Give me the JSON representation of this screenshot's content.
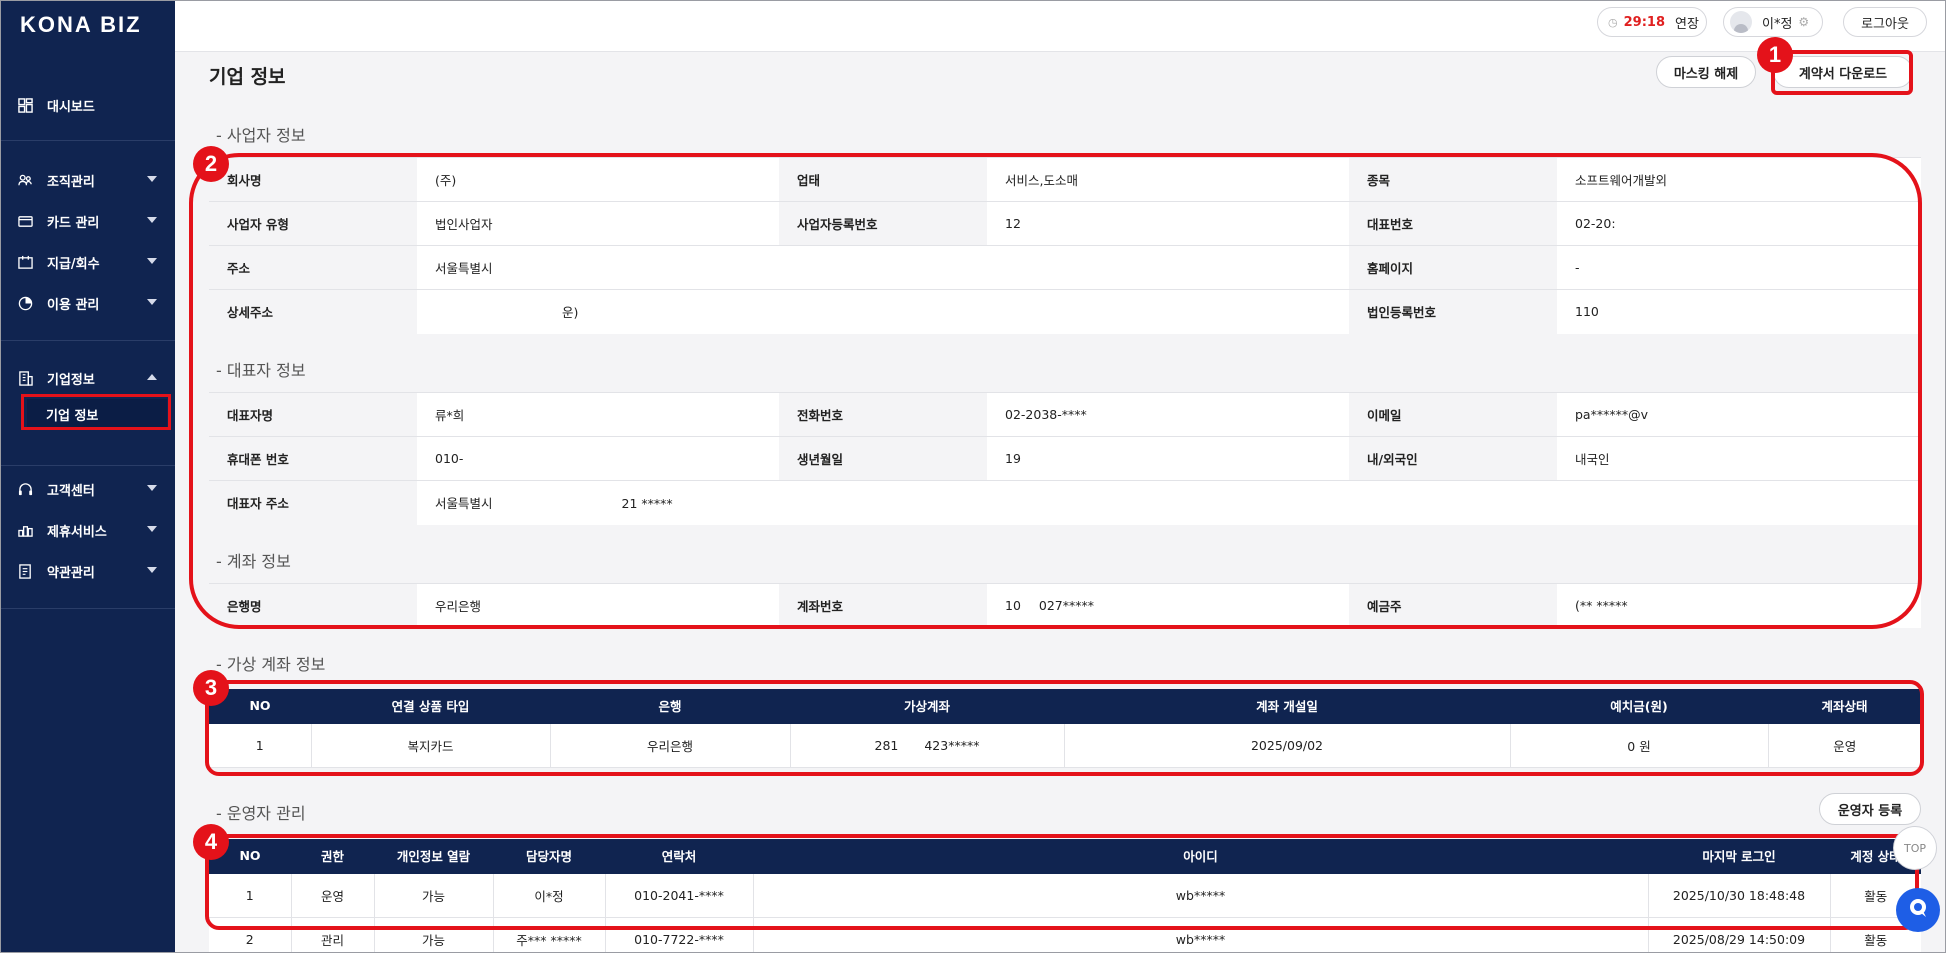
{
  "app": {
    "logo": "KONA BIZ"
  },
  "sidebar": {
    "items": [
      {
        "label": "대시보드",
        "icon": "dashboard-icon"
      },
      {
        "label": "조직관리",
        "icon": "org-icon"
      },
      {
        "label": "카드 관리",
        "icon": "card-icon"
      },
      {
        "label": "지급/회수",
        "icon": "payment-icon"
      },
      {
        "label": "이용 관리",
        "icon": "usage-icon"
      },
      {
        "label": "기업정보",
        "icon": "building-icon"
      },
      {
        "label": "고객센터",
        "icon": "headset-icon"
      },
      {
        "label": "제휴서비스",
        "icon": "partner-icon"
      },
      {
        "label": "약관관리",
        "icon": "document-icon"
      }
    ],
    "active_sub": "기업 정보"
  },
  "topbar": {
    "timer": "29:18",
    "extend": "연장",
    "user": "이*정",
    "logout": "로그아웃"
  },
  "page": {
    "title": "기업 정보",
    "unmask_button": "마스킹 해제",
    "download_button": "계약서 다운로드"
  },
  "business": {
    "section_title": "- 사업자 정보",
    "rows": [
      [
        "회사명",
        "(주)",
        "업태",
        "서비스,도소매",
        "종목",
        "소프트웨어개발외"
      ],
      [
        "사업자 유형",
        "법인사업자",
        "사업자등록번호",
        "12",
        "대표번호",
        "02-20:"
      ],
      [
        "주소",
        "서울특별시",
        "",
        "",
        "홈페이지",
        "-"
      ],
      [
        "상세주소",
        "운)",
        "",
        "",
        "법인등록번호",
        "110"
      ]
    ]
  },
  "ceo": {
    "section_title": "- 대표자 정보",
    "rows": [
      [
        "대표자명",
        "류*희",
        "전화번호",
        "02-2038-****",
        "이메일",
        "pa******@v"
      ],
      [
        "휴대폰 번호",
        "010-",
        "생년월일",
        "19",
        "내/외국인",
        "내국인"
      ],
      [
        "대표자 주소",
        "서울특별시",
        "21 *****"
      ]
    ]
  },
  "account": {
    "section_title": "- 계좌 정보",
    "rows": [
      [
        "은행명",
        "우리은행",
        "계좌번호",
        "10",
        "027*****",
        "예금주",
        "(** *****"
      ]
    ]
  },
  "virtual_account": {
    "section_title": "- 가상 계좌 정보",
    "headers": [
      "NO",
      "연결 상품 타입",
      "은행",
      "가상계좌",
      "계좌 개설일",
      "예치금(원)",
      "계좌상태"
    ],
    "rows": [
      [
        "1",
        "복지카드",
        "우리은행",
        "281",
        "423*****",
        "2025/09/02",
        "0 원",
        "운영"
      ]
    ]
  },
  "operators": {
    "section_title": "- 운영자 관리",
    "register_button": "운영자 등록",
    "headers": [
      "NO",
      "권한",
      "개인정보 열람",
      "담당자명",
      "연락처",
      "아이디",
      "마지막 로그인",
      "계정 상태"
    ],
    "rows": [
      [
        "1",
        "운영",
        "가능",
        "이*정",
        "010-2041-****",
        "wb*****",
        "2025/10/30 18:48:48",
        "활동"
      ],
      [
        "2",
        "관리",
        "가능",
        "주*** *****",
        "010-7722-****",
        "wb*****",
        "2025/08/29 14:50:09",
        "활동"
      ]
    ]
  },
  "annotations": [
    "1",
    "2",
    "3",
    "4"
  ],
  "floating": {
    "top_label": "TOP"
  },
  "colors": {
    "sidebar": "#102450",
    "accent_red": "#e4121a",
    "timer": "#e02020",
    "header_bg": "#102450"
  }
}
